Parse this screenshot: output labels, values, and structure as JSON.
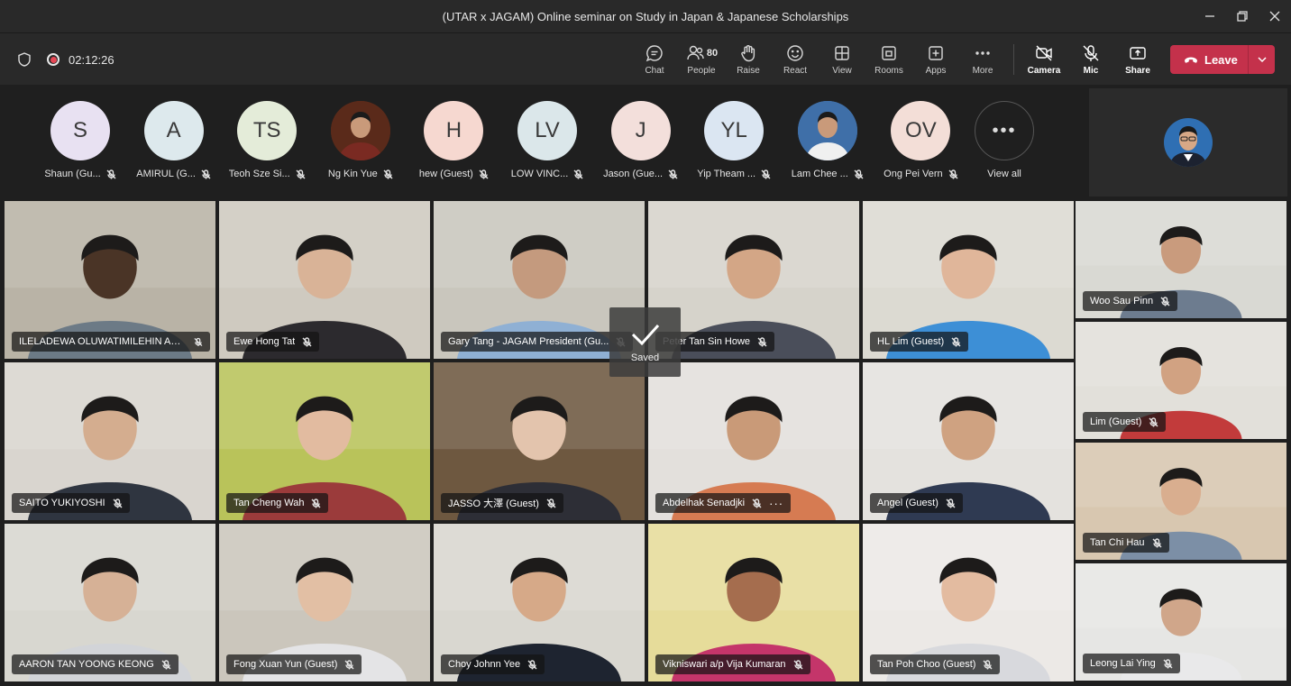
{
  "window": {
    "title": "(UTAR x JAGAM) Online seminar on Study in Japan & Japanese Scholarships"
  },
  "toolbar": {
    "timer": "02:12:26",
    "people_count": "80",
    "buttons": {
      "chat": "Chat",
      "people": "People",
      "raise": "Raise",
      "react": "React",
      "view": "View",
      "rooms": "Rooms",
      "apps": "Apps",
      "more": "More",
      "camera": "Camera",
      "mic": "Mic",
      "share": "Share"
    },
    "leave": "Leave"
  },
  "strip": [
    {
      "initials": "S",
      "name": "Shaun (Gu...",
      "color": "#e8e1f2"
    },
    {
      "initials": "A",
      "name": "AMIRUL (G...",
      "color": "#dde9ed"
    },
    {
      "initials": "TS",
      "name": "Teoh Sze Si...",
      "color": "#e4ecd9"
    },
    {
      "initials": "",
      "name": "Ng Kin Yue",
      "color": "#5a2a1a"
    },
    {
      "initials": "H",
      "name": "hew (Guest)",
      "color": "#f6d8d0"
    },
    {
      "initials": "LV",
      "name": "LOW VINC...",
      "color": "#dbe7ea"
    },
    {
      "initials": "J",
      "name": "Jason (Gue...",
      "color": "#f3dfdb"
    },
    {
      "initials": "YL",
      "name": "Yip Theam ...",
      "color": "#dbe6f2"
    },
    {
      "initials": "",
      "name": "Lam Chee ...",
      "color": "#3f6fa8"
    },
    {
      "initials": "OV",
      "name": "Ong Pei Vern",
      "color": "#f3ded7"
    }
  ],
  "view_all": "View all",
  "toast": "Saved",
  "tiles": [
    {
      "name": "ILELADEWA OLUWATIMILEHIN ADEKU...",
      "bg": "#b9b3a6",
      "skin": "#4a3426",
      "shirt": "#6c7a86"
    },
    {
      "name": "Ewe Hong Tat",
      "bg": "#cfcac0",
      "skin": "#d9b397",
      "shirt": "#2c2a2e"
    },
    {
      "name": "Gary Tang - JAGAM President (Gu...",
      "bg": "#c9c6bd",
      "skin": "#c49a7e",
      "shirt": "#8fb0d4"
    },
    {
      "name": "Peter Tan Sin Howe",
      "bg": "#d6d3cb",
      "skin": "#d3a686",
      "shirt": "#4a4e5a"
    },
    {
      "name": "HL Lim (Guest)",
      "bg": "#dcdad2",
      "skin": "#e0b69a",
      "shirt": "#3d8fd6"
    },
    {
      "name": "Woo Sau Pinn",
      "bg": "#d9d9d3",
      "skin": "#c99b7d",
      "shirt": "#6d7c8f"
    },
    {
      "name": "SAITO YUKIYOSHI",
      "bg": "#d9d5cf",
      "skin": "#d4ad8f",
      "shirt": "#2f3540"
    },
    {
      "name": "Tan Cheng Wah",
      "bg": "#b9c35a",
      "skin": "#e2bba0",
      "shirt": "#9b3b3b"
    },
    {
      "name": "JASSO 大澤 (Guest)",
      "bg": "#6e5840",
      "skin": "#e3c4ad",
      "shirt": "#2d2e36"
    },
    {
      "name": "Abdelhak Senadjki",
      "bg": "#e3e0dc",
      "skin": "#c99a78",
      "shirt": "#d67b52"
    },
    {
      "name": "Angel (Guest)",
      "bg": "#e4e2de",
      "skin": "#cfa281",
      "shirt": "#2f3a52"
    },
    {
      "name": "Lim (Guest)",
      "bg": "#e2e0da",
      "skin": "#d1a282",
      "shirt": "#c23b3b"
    },
    {
      "name": "AARON TAN YOONG KEONG",
      "bg": "#d8d7d0",
      "skin": "#d6b196",
      "shirt": "#d2d4d8"
    },
    {
      "name": "Fong Xuan Yun (Guest)",
      "bg": "#cbc6bc",
      "skin": "#e2bfa4",
      "shirt": "#e4e4e6"
    },
    {
      "name": "Choy Johnn Yee",
      "bg": "#d9d7d0",
      "skin": "#d6a988",
      "shirt": "#1e2430"
    },
    {
      "name": "Vikniswari a/p Vija Kumaran",
      "bg": "#e6dc9a",
      "skin": "#a56d4e",
      "shirt": "#c4356a"
    },
    {
      "name": "Tan Poh Choo (Guest)",
      "bg": "#ece9e6",
      "skin": "#e3bba0",
      "shirt": "#d8d9dd"
    },
    {
      "name": "Tan Chi Hau",
      "bg": "#d8c7b0",
      "skin": "#d9ae8f",
      "shirt": "#7c8fa6"
    },
    {
      "name": "Leong Lai Ying",
      "bg": "#e6e6e4",
      "skin": "#d0a68a",
      "shirt": "#e9e9ea"
    }
  ]
}
